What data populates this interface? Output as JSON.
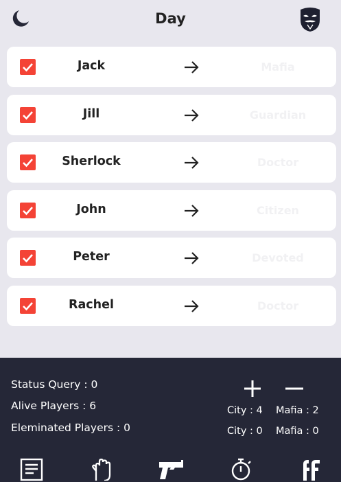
{
  "header": {
    "title": "Day",
    "left_icon": "moon-icon",
    "right_icon": "mask-icon"
  },
  "players": [
    {
      "name": "Jack",
      "role": "Mafia",
      "checked": true
    },
    {
      "name": "Jill",
      "role": "Guardian",
      "checked": true
    },
    {
      "name": "Sherlock",
      "role": "Doctor",
      "checked": true
    },
    {
      "name": "John",
      "role": "Citizen",
      "checked": true
    },
    {
      "name": "Peter",
      "role": "Devoted",
      "checked": true
    },
    {
      "name": "Rachel",
      "role": "Doctor",
      "checked": true
    }
  ],
  "stats": {
    "status_query": "Status Query : 0",
    "alive": "Alive Players : 6",
    "eliminated": "Eleminated Players : 0"
  },
  "counts": {
    "city_plus": "City : 4",
    "mafia_plus": "Mafia : 2",
    "city_minus": "City : 0",
    "mafia_minus": "Mafia : 0"
  },
  "nav": [
    "list-icon",
    "hand-icon",
    "gun-icon",
    "stopwatch-icon",
    "ff-icon"
  ],
  "colors": {
    "checkbox": "#f44336",
    "panel": "#252737",
    "background": "#e8e7ee"
  }
}
